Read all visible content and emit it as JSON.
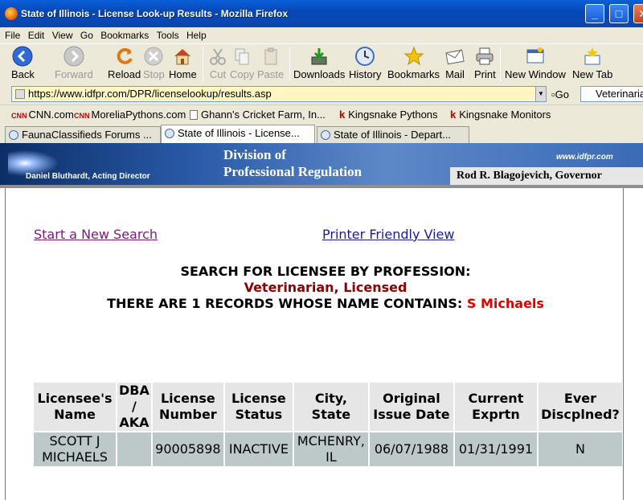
{
  "window": {
    "title": "State of Illinois - License Look-up Results - Mozilla Firefox",
    "minimize": "_",
    "maximize": "□",
    "close": "✕"
  },
  "menu": [
    "File",
    "Edit",
    "View",
    "Go",
    "Bookmarks",
    "Tools",
    "Help"
  ],
  "toolbar": {
    "back": "Back",
    "forward": "Forward",
    "reload": "Reload",
    "stop": "Stop",
    "home": "Home",
    "cut": "Cut",
    "copy": "Copy",
    "paste": "Paste",
    "downloads": "Downloads",
    "history": "History",
    "bookmarks": "Bookmarks",
    "mail": "Mail",
    "print": "Print",
    "new_window": "New Window",
    "new_tab": "New Tab"
  },
  "urlbar": {
    "url": "https://www.idfpr.com/DPR/licenselookup/results.asp",
    "go": "Go",
    "search_value": "Veterinarian"
  },
  "bookmarks": [
    {
      "label": "CNN.com",
      "icon": "cnn-icon"
    },
    {
      "label": "MoreliaPythons.com",
      "icon": "cnn-icon"
    },
    {
      "label": "Ghann's Cricket Farm, In...",
      "icon": "page-icon"
    },
    {
      "label": "Kingsnake Pythons",
      "icon": "kingsnake-icon"
    },
    {
      "label": "Kingsnake Monitors",
      "icon": "kingsnake-icon"
    }
  ],
  "tabs": [
    {
      "label": "FaunaClassifieds Forums ...",
      "active": false
    },
    {
      "label": "State of Illinois - License...",
      "active": true
    },
    {
      "label": "State of Illinois - Depart...",
      "active": false
    }
  ],
  "banner": {
    "director": "Daniel Bluthardt, Acting Director",
    "division_line1": "Division of",
    "division_line2": "Professional Regulation",
    "site": "www.idfpr.com",
    "governor": "Rod R. Blagojevich, Governor"
  },
  "links": {
    "new_search": "Start a New Search",
    "printer_friendly": "Printer Friendly View"
  },
  "heading": {
    "line1": "SEARCH FOR LICENSEE BY PROFESSION:",
    "profession": "Veterinarian, Licensed",
    "line3_prefix": "THERE ARE 1 RECORDS WHOSE NAME CONTAINS:",
    "search_name": "S Michaels"
  },
  "table": {
    "headers": [
      "Licensee's Name",
      "DBA / AKA",
      "License Number",
      "License Status",
      "City, State",
      "Original Issue Date",
      "Current Exprtn",
      "Ever Discplned?"
    ],
    "rows": [
      [
        "SCOTT J MICHAELS",
        "",
        "90005898",
        "INACTIVE",
        "MCHENRY, IL",
        "06/07/1988",
        "01/31/1991",
        "N"
      ]
    ]
  }
}
